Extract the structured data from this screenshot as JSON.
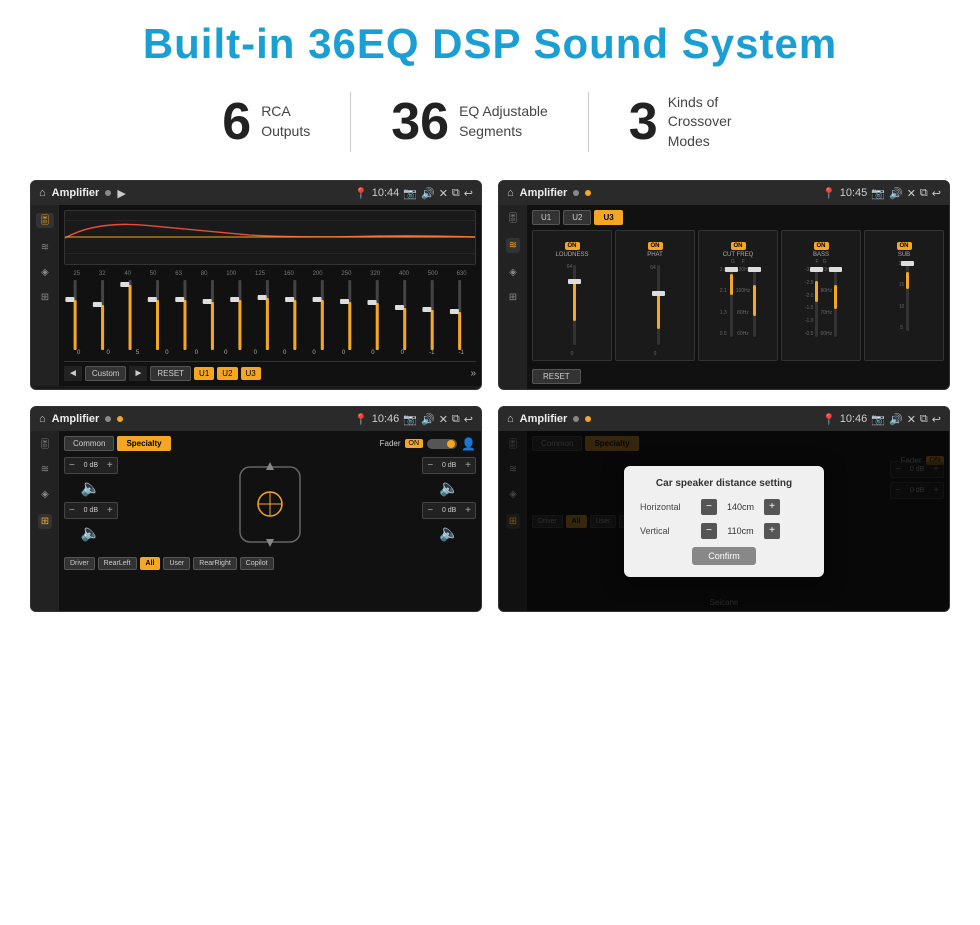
{
  "header": {
    "title": "Built-in 36EQ DSP Sound System"
  },
  "stats": [
    {
      "number": "6",
      "label": "RCA\nOutputs"
    },
    {
      "number": "36",
      "label": "EQ Adjustable\nSegments"
    },
    {
      "number": "3",
      "label": "Kinds of\nCrossover Modes"
    }
  ],
  "screens": [
    {
      "id": "screen1",
      "topbar": {
        "title": "Amplifier",
        "time": "10:44"
      },
      "type": "eq"
    },
    {
      "id": "screen2",
      "topbar": {
        "title": "Amplifier",
        "time": "10:45"
      },
      "type": "crossover"
    },
    {
      "id": "screen3",
      "topbar": {
        "title": "Amplifier",
        "time": "10:46"
      },
      "type": "common"
    },
    {
      "id": "screen4",
      "topbar": {
        "title": "Amplifier",
        "time": "10:46"
      },
      "type": "distance"
    }
  ],
  "eq": {
    "frequencies": [
      "25",
      "32",
      "40",
      "50",
      "63",
      "80",
      "100",
      "125",
      "160",
      "200",
      "250",
      "320",
      "400",
      "500",
      "630"
    ],
    "values": [
      "0",
      "0",
      "5",
      "0",
      "0",
      "0",
      "0",
      "0",
      "0",
      "0",
      "0",
      "0",
      "-1",
      "-1"
    ],
    "sliderHeights": [
      50,
      45,
      65,
      50,
      50,
      48,
      50,
      52,
      50,
      50,
      48,
      47,
      40,
      40,
      35
    ],
    "controls": {
      "prev": "◄",
      "preset": "Custom",
      "next": "►",
      "reset": "RESET",
      "u1": "U1",
      "u2": "U2",
      "u3": "U3"
    }
  },
  "crossover": {
    "presets": [
      "U1",
      "U2",
      "U3"
    ],
    "channels": [
      {
        "name": "LOUDNESS",
        "on": true
      },
      {
        "name": "PHAT",
        "on": true
      },
      {
        "name": "CUT FREQ",
        "on": true
      },
      {
        "name": "BASS",
        "on": true
      },
      {
        "name": "SUB",
        "on": true
      }
    ],
    "reset": "RESET"
  },
  "common": {
    "tabs": [
      "Common",
      "Specialty"
    ],
    "fader": "Fader",
    "faderOn": "ON",
    "positions": [
      "Driver",
      "RearLeft",
      "All",
      "User",
      "RearRight",
      "Copilot"
    ],
    "activePosition": "All"
  },
  "distance": {
    "dialog": {
      "title": "Car speaker distance setting",
      "horizontal": {
        "label": "Horizontal",
        "value": "140cm"
      },
      "vertical": {
        "label": "Vertical",
        "value": "110cm"
      },
      "confirm": "Confirm"
    }
  }
}
